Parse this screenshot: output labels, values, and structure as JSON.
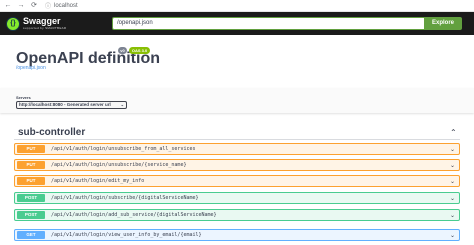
{
  "browser": {
    "back_icon": "arrow-left-icon",
    "forward_icon": "arrow-right-icon",
    "reload_icon": "reload-icon",
    "back_glyph": "←",
    "forward_glyph": "→",
    "reload_glyph": "⟳",
    "info_glyph": "ⓘ",
    "url": "localhost"
  },
  "topbar": {
    "brand": "Swagger",
    "brand_sub": "supported by SMARTBEAR",
    "logo_glyph": "{}",
    "spec_url": "/openapi.json",
    "explore_label": "Explore",
    "accent": "#62a03f"
  },
  "info": {
    "title": "OpenAPI definition",
    "version_badge": "v0",
    "oas_badge": "OAS 3.0",
    "spec_link": "/openapi.json"
  },
  "servers": {
    "label": "Servers",
    "selected": "http://localhost:8080 - Generated server url",
    "caret": "⌄"
  },
  "controller": {
    "title": "sub-controller",
    "chevron": "⌃"
  },
  "operations": [
    {
      "method": "PUT",
      "path": "/api/v1/auth/login/unsubscribe_from_all_services",
      "chevron": "⌄"
    },
    {
      "method": "PUT",
      "path": "/api/v1/auth/login/unsubscribe/{service_name}",
      "chevron": "⌄"
    },
    {
      "method": "PUT",
      "path": "/api/v1/auth/login/edit_my_info",
      "chevron": "⌄"
    },
    {
      "method": "POST",
      "path": "/api/v1/auth/login/subscribe/{digitalServiceName}",
      "chevron": "⌄"
    },
    {
      "method": "POST",
      "path": "/api/v1/auth/login/add_sub_service/{digitalServiceName}",
      "chevron": "⌄"
    },
    {
      "method": "GET",
      "path": "/api/v1/auth/login/view_user_info_by_email/{email}",
      "chevron": "⌄"
    }
  ],
  "colors": {
    "put": "#fca130",
    "post": "#49cc90",
    "get": "#61affe"
  }
}
